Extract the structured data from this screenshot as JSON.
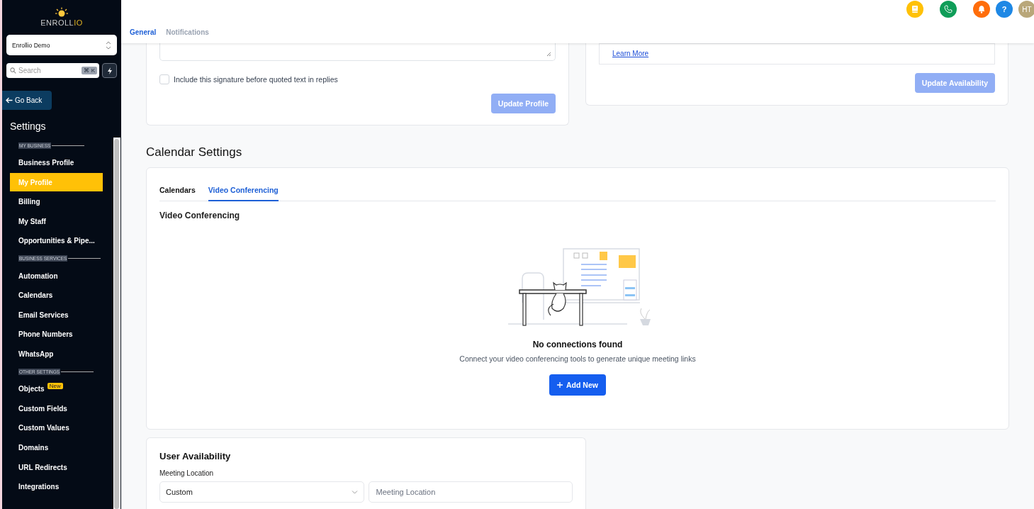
{
  "sidebar": {
    "logo": {
      "main": "ENROLL",
      "accent": "IO"
    },
    "account_switcher": {
      "value": "Enrollio Demo"
    },
    "search": {
      "placeholder": "Search",
      "shortcut": "⌘ K"
    },
    "go_back": "Go Back",
    "title": "Settings",
    "sections": [
      {
        "title": "MY BUSINESS",
        "items": [
          {
            "label": "Business Profile",
            "selected": false
          },
          {
            "label": "My Profile",
            "selected": true
          },
          {
            "label": "Billing",
            "selected": false
          },
          {
            "label": "My Staff",
            "selected": false
          },
          {
            "label": "Opportunities & Pipe...",
            "selected": false
          }
        ]
      },
      {
        "title": "BUSINESS SERVICES",
        "items": [
          {
            "label": "Automation",
            "selected": false
          },
          {
            "label": "Calendars",
            "selected": false
          },
          {
            "label": "Email Services",
            "selected": false
          },
          {
            "label": "Phone Numbers",
            "selected": false
          },
          {
            "label": "WhatsApp",
            "selected": false
          }
        ]
      },
      {
        "title": "OTHER SETTINGS",
        "items": [
          {
            "label": "Objects",
            "selected": false,
            "badge": "New"
          },
          {
            "label": "Custom Fields",
            "selected": false
          },
          {
            "label": "Custom Values",
            "selected": false
          },
          {
            "label": "Domains",
            "selected": false
          },
          {
            "label": "URL Redirects",
            "selected": false
          },
          {
            "label": "Integrations",
            "selected": false
          }
        ]
      }
    ]
  },
  "header": {
    "tabs": [
      {
        "label": "General",
        "selected": true
      },
      {
        "label": "Notifications",
        "selected": false
      }
    ],
    "actions": [
      {
        "kind": "book",
        "color": "#ffc107"
      },
      {
        "kind": "phone",
        "color": "#0f9d58"
      },
      {
        "kind": "bell",
        "color": "#ff6d0a"
      },
      {
        "kind": "help",
        "color": "#1e88e5",
        "text": "?"
      },
      {
        "kind": "avatar",
        "color": "#b9a77a",
        "text": "HT"
      }
    ]
  },
  "profile_card": {
    "signature_checkbox": {
      "label": "Include this signature before quoted text in replies",
      "checked": false
    },
    "button": {
      "label": "Update Profile",
      "disabled": true
    }
  },
  "availability_card": {
    "link": "Learn More",
    "button": {
      "label": "Update Availability",
      "disabled": true
    }
  },
  "calendar_settings": {
    "title": "Calendar Settings",
    "tabs": [
      {
        "label": "Calendars",
        "selected": false
      },
      {
        "label": "Video Conferencing",
        "selected": true
      }
    ],
    "section_title": "Video Conferencing",
    "empty_title": "No connections found",
    "empty_text": "Connect your video conferencing tools to generate unique meeting links",
    "add_button": "Add New"
  },
  "user_availability": {
    "title": "User Availability",
    "field_label": "Meeting Location",
    "select_value": "Custom",
    "input_placeholder": "Meeting Location"
  }
}
